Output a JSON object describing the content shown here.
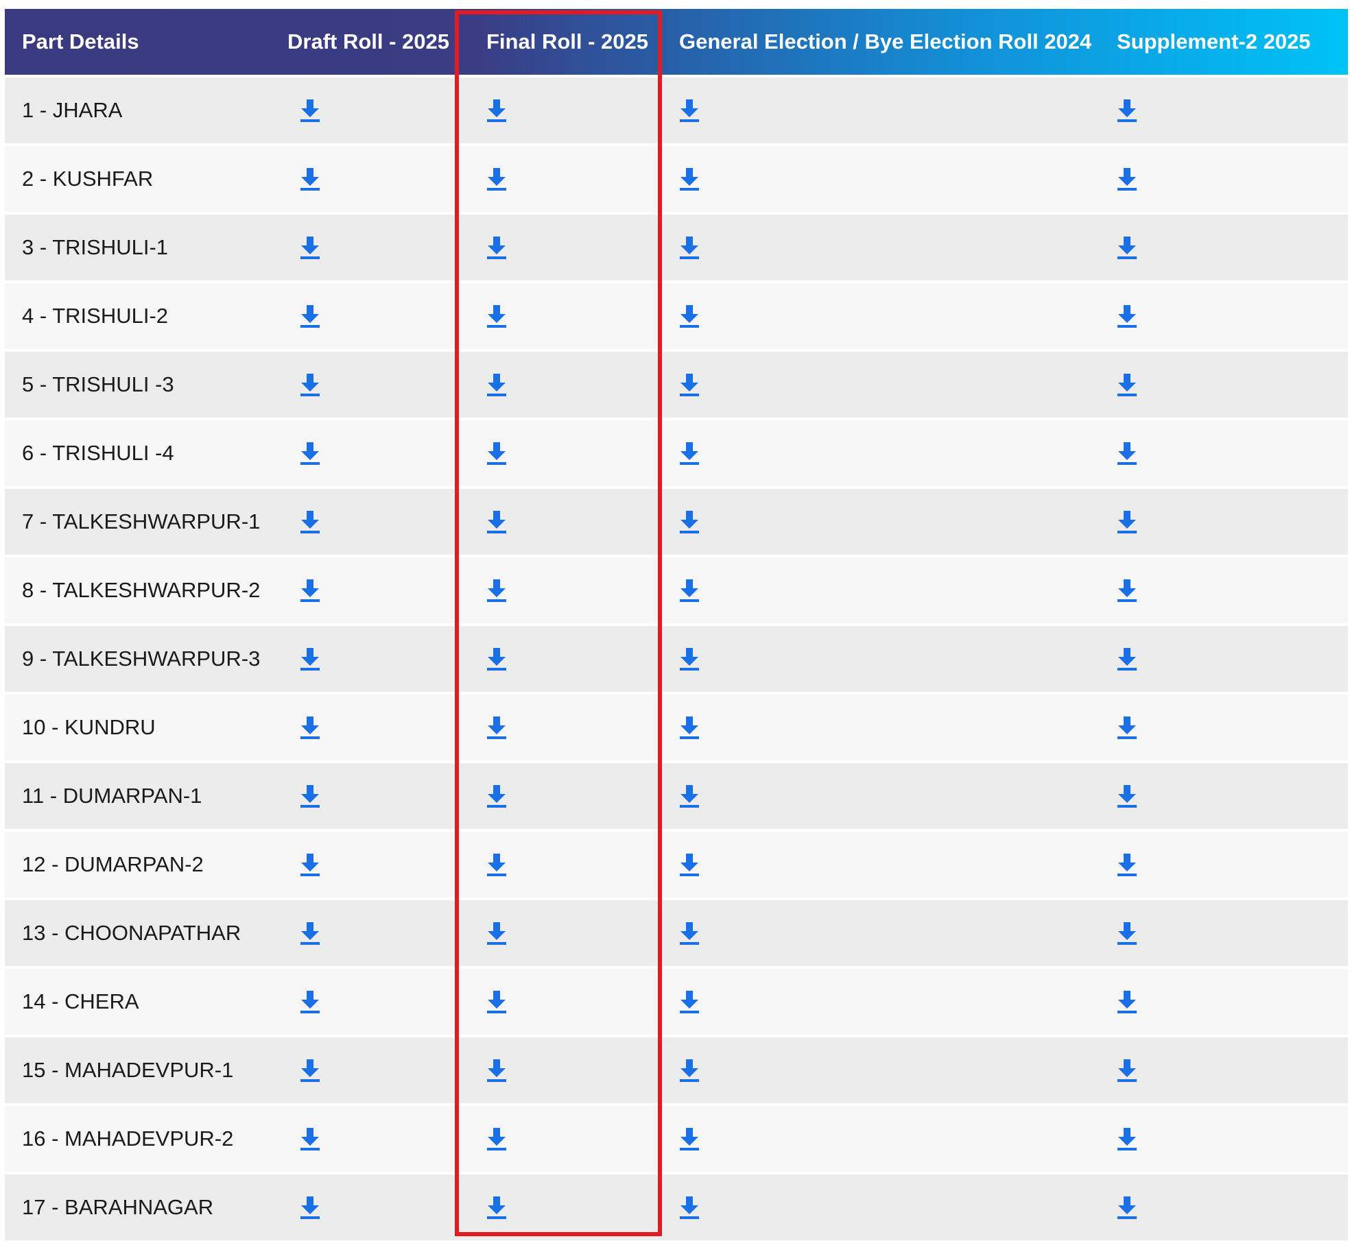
{
  "table": {
    "headers": {
      "part": "Part Details",
      "draft": "Draft Roll - 2025",
      "final": "Final Roll - 2025",
      "general": "General Election / Bye Election Roll 2024",
      "supplement": "Supplement-2 2025"
    },
    "rows": [
      {
        "part": "1 - JHARA"
      },
      {
        "part": "2 - KUSHFAR"
      },
      {
        "part": "3 - TRISHULI-1"
      },
      {
        "part": "4 - TRISHULI-2"
      },
      {
        "part": "5 - TRISHULI -3"
      },
      {
        "part": "6 - TRISHULI -4"
      },
      {
        "part": "7 - TALKESHWARPUR-1"
      },
      {
        "part": "8 - TALKESHWARPUR-2"
      },
      {
        "part": "9 - TALKESHWARPUR-3"
      },
      {
        "part": "10 - KUNDRU"
      },
      {
        "part": "11 - DUMARPAN-1"
      },
      {
        "part": "12 - DUMARPAN-2"
      },
      {
        "part": "13 - CHOONAPATHAR"
      },
      {
        "part": "14 - CHERA"
      },
      {
        "part": "15 - MAHADEVPUR-1"
      },
      {
        "part": "16 - MAHADEVPUR-2"
      },
      {
        "part": "17 - BARAHNAGAR"
      }
    ],
    "icon": "download-icon"
  },
  "colors": {
    "header_start": "#3a3a80",
    "header_end": "#00c2f5",
    "download_icon": "#1a6fe6",
    "highlight_border": "#e21b23",
    "row_odd": "#ececec",
    "row_even": "#f6f6f6"
  },
  "highlight": {
    "column": "final"
  }
}
